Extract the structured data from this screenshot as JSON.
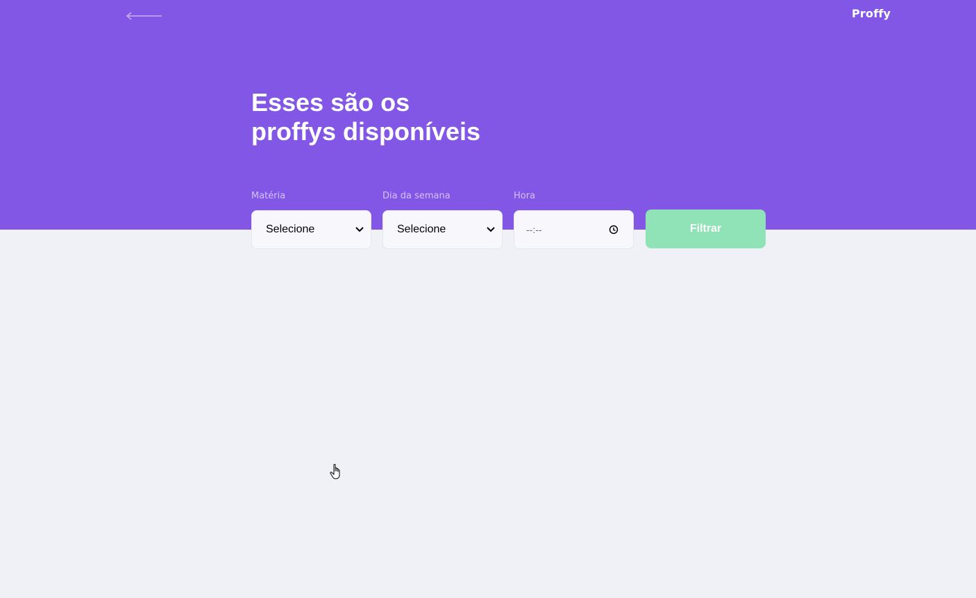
{
  "header": {
    "logo": "Proffy",
    "back_icon": "arrow-left-icon",
    "title_line1": "Esses são os",
    "title_line2": "proffys disponíveis"
  },
  "filters": {
    "subject": {
      "label": "Matéria",
      "value": "Selecione"
    },
    "weekday": {
      "label": "Dia da semana",
      "value": "Selecione"
    },
    "time": {
      "label": "Hora",
      "value": "--:--"
    },
    "submit_label": "Filtrar"
  },
  "colors": {
    "primary": "#8257E5",
    "background": "#F0F0F7",
    "label": "#D4C2FF",
    "button": "#8FE3B6",
    "input_bg": "#F8F8FC"
  }
}
